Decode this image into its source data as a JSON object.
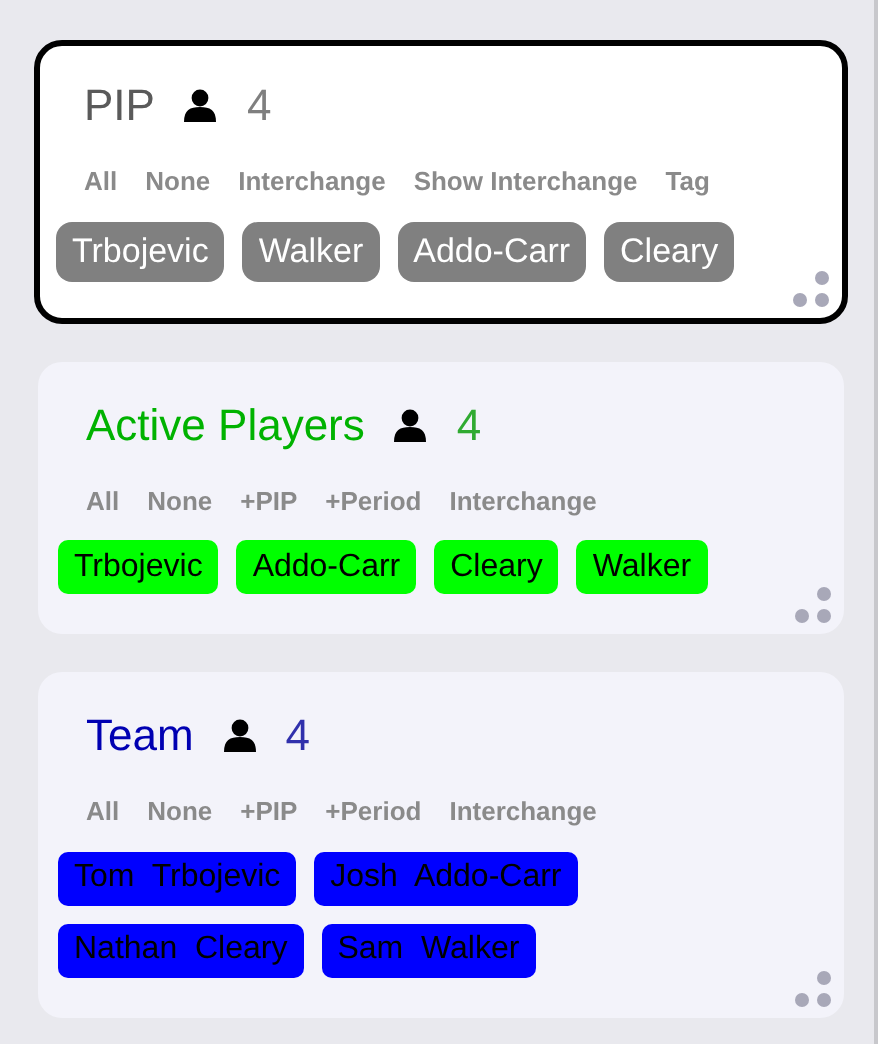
{
  "panels": [
    {
      "title": "PIP",
      "count": "4",
      "color": "#808080",
      "selected": true,
      "actions": [
        "All",
        "None",
        "Interchange",
        "Show Interchange",
        "Tag"
      ],
      "players": [
        "Trbojevic",
        "Walker",
        "Addo-Carr",
        "Cleary"
      ]
    },
    {
      "title": "Active Players",
      "count": "4",
      "color": "#00ff00",
      "selected": false,
      "actions": [
        "All",
        "None",
        "+PIP",
        "+Period",
        "Interchange"
      ],
      "players": [
        "Trbojevic",
        "Addo-Carr",
        "Cleary",
        "Walker"
      ]
    },
    {
      "title": "Team",
      "count": "4",
      "color": "#0000ff",
      "selected": false,
      "actions": [
        "All",
        "None",
        "+PIP",
        "+Period",
        "Interchange"
      ],
      "players": [
        "Tom  Trbojevic",
        "Josh  Addo-Carr",
        "Nathan  Cleary",
        "Sam  Walker"
      ]
    }
  ]
}
